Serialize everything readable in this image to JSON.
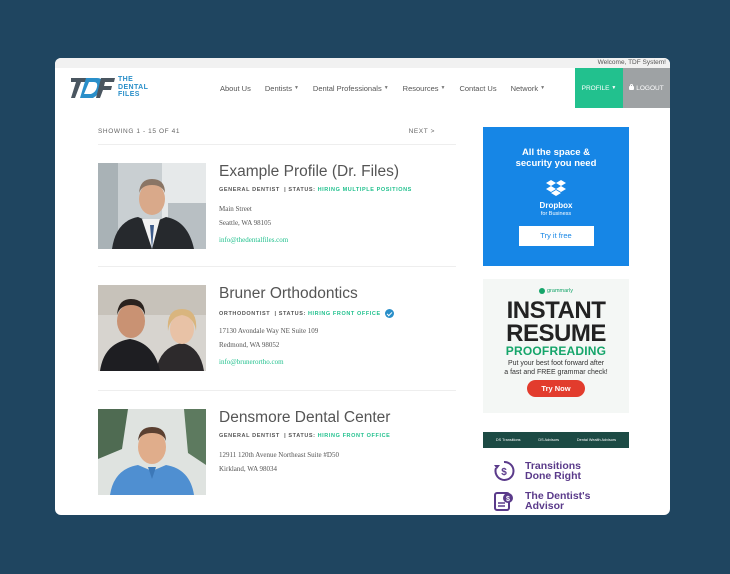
{
  "topbar": {
    "welcome": "Welcome, TDF System!"
  },
  "brand": {
    "line1": "THE",
    "line2": "DENTAL",
    "line3": "FILES"
  },
  "nav": {
    "items": [
      {
        "label": "About Us",
        "dropdown": false
      },
      {
        "label": "Dentists",
        "dropdown": true
      },
      {
        "label": "Dental Professionals",
        "dropdown": true
      },
      {
        "label": "Resources",
        "dropdown": true
      },
      {
        "label": "Contact Us",
        "dropdown": false
      },
      {
        "label": "Network",
        "dropdown": true
      }
    ],
    "profile": "PROFILE",
    "logout": "LOGOUT"
  },
  "pager": {
    "showing": "SHOWING 1 - 15 OF 41",
    "next": "NEXT >"
  },
  "listings": [
    {
      "name": "Example Profile (Dr. Files)",
      "role": "GENERAL DENTIST",
      "status_label": "| STATUS:",
      "status": "HIRING MULTIPLE POSITIONS",
      "verified": false,
      "address1": "Main Street",
      "address2": "Seattle, WA 98105",
      "email": "info@thedentalfiles.com"
    },
    {
      "name": "Bruner Orthodontics",
      "role": "ORTHODONTIST",
      "status_label": "| STATUS:",
      "status": "HIRING FRONT OFFICE",
      "verified": true,
      "address1": "17130 Avondale Way NE Suite 109",
      "address2": "Redmond, WA 98052",
      "email": "info@brunerortho.com"
    },
    {
      "name": "Densmore Dental Center",
      "role": "GENERAL DENTIST",
      "status_label": "| STATUS:",
      "status": "HIRING FRONT OFFICE",
      "verified": false,
      "address1": "12911 120th Avenue Northeast Suite #D50",
      "address2": "Kirkland, WA 98034",
      "email": ""
    }
  ],
  "ads": {
    "dropbox": {
      "headline1": "All the space &",
      "headline2": "security you need",
      "brand": "Dropbox",
      "sub": "for Business",
      "button": "Try it free"
    },
    "grammarly": {
      "brand": "grammarly",
      "line1": "INSTANT",
      "line2": "RESUME",
      "line3": "PROOFREADING",
      "body1": "Put your best foot forward after",
      "body2": "a fast and FREE grammar check!",
      "button": "Try Now"
    },
    "dental": {
      "strip": [
        "DS Transitions",
        "DS Advisors",
        "Dental Wealth Advisors"
      ],
      "row1_line1": "Transitions",
      "row1_line2": "Done Right",
      "row2_line1": "The Dentist's",
      "row2_line2": "Advisor"
    }
  },
  "colors": {
    "accent_green": "#22c18e",
    "brand_blue": "#2a8fc9",
    "background": "#1f4560"
  }
}
